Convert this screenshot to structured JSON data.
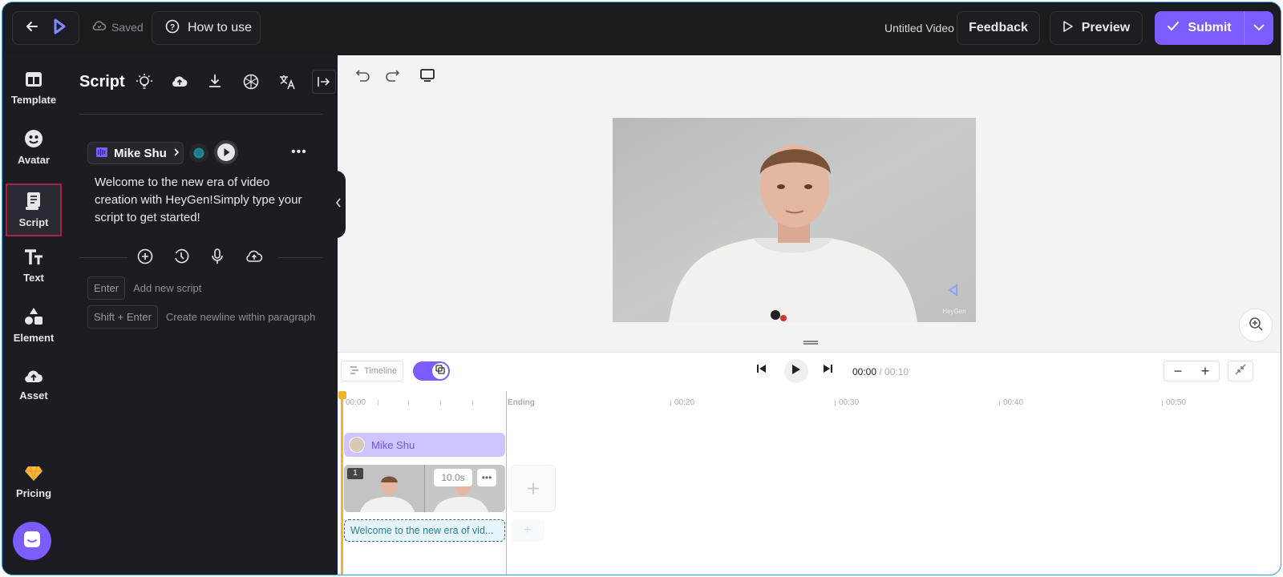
{
  "topbar": {
    "saved_label": "Saved",
    "how_to_use_label": "How to use",
    "video_title": "Untitled Video",
    "feedback_label": "Feedback",
    "preview_label": "Preview",
    "submit_label": "Submit"
  },
  "rail": {
    "items": [
      {
        "label": "Template",
        "icon": "template-icon"
      },
      {
        "label": "Avatar",
        "icon": "avatar-icon"
      },
      {
        "label": "Script",
        "icon": "script-icon",
        "active": true
      },
      {
        "label": "Text",
        "icon": "text-icon"
      },
      {
        "label": "Element",
        "icon": "element-icon"
      },
      {
        "label": "Asset",
        "icon": "asset-icon"
      }
    ],
    "pricing_label": "Pricing"
  },
  "panel": {
    "title": "Script",
    "voice_name": "Mike Shu",
    "script_text": "Welcome to the new era of video creation with HeyGen!Simply type your script to get started!",
    "hints": [
      {
        "key": "Enter",
        "text": "Add new script"
      },
      {
        "key": "Shift + Enter",
        "text": "Create newline within paragraph"
      }
    ]
  },
  "canvas": {
    "watermark": "HeyGen"
  },
  "timeline": {
    "timeline_label": "Timeline",
    "current_time": "00:00",
    "duration": "00:10",
    "ruler": {
      "start": "00:00",
      "ending": "Ending",
      "marks": [
        "00:20",
        "00:30",
        "00:40",
        "00:50"
      ]
    },
    "avatar_track_label": "Mike Shu",
    "scene_number": "1",
    "scene_duration": "10.0s",
    "text_track_label": "Welcome to the new era of vid..."
  },
  "colors": {
    "accent": "#7c5cff",
    "active_border": "#b01e4a",
    "playhead": "#f0b431"
  }
}
